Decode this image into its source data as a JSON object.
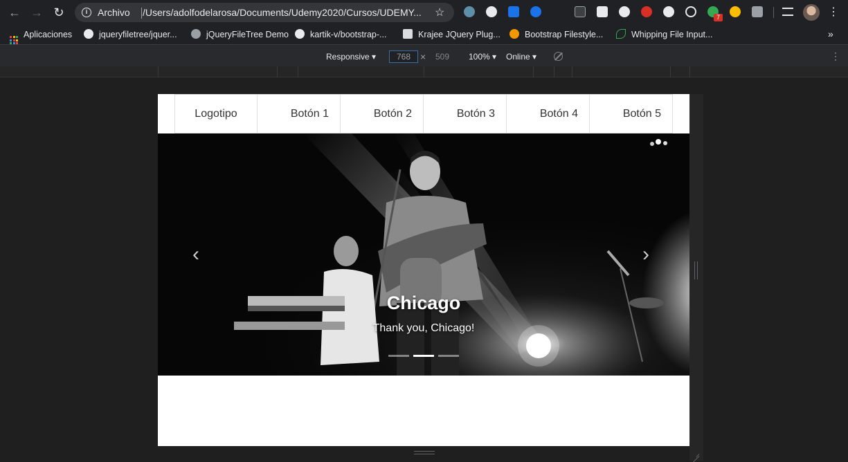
{
  "browser": {
    "back_icon": "arrow-left-icon",
    "forward_icon": "arrow-right-icon",
    "reload_icon": "reload-icon",
    "scheme_label": "Archivo",
    "url": "/Users/adolfodelarosa/Documents/Udemy2020/Cursos/UDEMY...",
    "extension_badge": "7",
    "bookmark_icon": "star-icon",
    "menu_icon": "kebab-menu-icon"
  },
  "bookmarks": [
    {
      "label": "Aplicaciones",
      "icon": "apps-grid-icon"
    },
    {
      "label": "jqueryfiletree/jquer...",
      "icon": "github-icon"
    },
    {
      "label": "jQueryFileTree Demo",
      "icon": "globe-icon"
    },
    {
      "label": "kartik-v/bootstrap-...",
      "icon": "github-icon"
    },
    {
      "label": "Krajee JQuery Plug...",
      "icon": "krajee-icon"
    },
    {
      "label": "Bootstrap Filestyle...",
      "icon": "filestyle-icon"
    },
    {
      "label": "Whipping File Input...",
      "icon": "leaf-icon"
    }
  ],
  "bookmarks_overflow": "»",
  "devtools": {
    "device": "Responsive ▾",
    "width": "768",
    "height": "509",
    "zoom": "100% ▾",
    "throttle": "Online ▾",
    "times": "×",
    "more": "⋮"
  },
  "page": {
    "nav": [
      "Logotipo",
      "Botón 1",
      "Botón 2",
      "Botón 3",
      "Botón 4",
      "Botón 5"
    ],
    "carousel": {
      "title": "Chicago",
      "caption": "Thank you, Chicago!",
      "prev": "‹",
      "next": "›",
      "slides": 3,
      "active_slide": 2
    }
  },
  "colors": {
    "chrome_bg": "#202124",
    "devbar_bg": "#292a2d",
    "page_bg": "#ffffff",
    "nav_border": "#dddddd"
  }
}
